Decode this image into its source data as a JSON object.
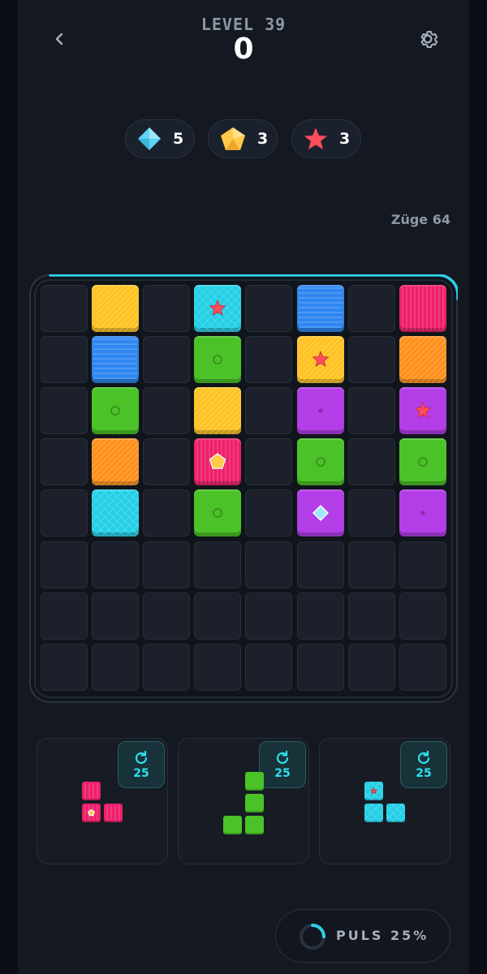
{
  "header": {
    "level_label": "LEVEL 39",
    "score": "0",
    "back_icon": "chevron-left-icon",
    "settings_icon": "gear-icon"
  },
  "goals": [
    {
      "icon": "diamond-icon",
      "color": "#5fd3f3",
      "count": "5"
    },
    {
      "icon": "pentagon-gem-icon",
      "color": "#ffc94a",
      "count": "3"
    },
    {
      "icon": "star-icon",
      "color": "#ff4d5a",
      "count": "3"
    }
  ],
  "moves_label": "Züge 64",
  "colors": {
    "yellow": "#ffc21f",
    "cyan": "#22cfe6",
    "blue": "#2f86f0",
    "magenta": "#ee1f6a",
    "green": "#4bc228",
    "orange": "#ff8f1a",
    "purple": "#b33ee8",
    "accent": "#2ecfea"
  },
  "board": {
    "size": 8,
    "tiles": [
      {
        "row": 0,
        "col": 1,
        "color": "yellow",
        "icon": ""
      },
      {
        "row": 0,
        "col": 3,
        "color": "cyan",
        "icon": "star"
      },
      {
        "row": 0,
        "col": 5,
        "color": "blue",
        "icon": ""
      },
      {
        "row": 0,
        "col": 7,
        "color": "magenta",
        "icon": ""
      },
      {
        "row": 1,
        "col": 1,
        "color": "blue",
        "icon": ""
      },
      {
        "row": 1,
        "col": 3,
        "color": "green",
        "icon": "ring"
      },
      {
        "row": 1,
        "col": 5,
        "color": "yellow",
        "icon": "star"
      },
      {
        "row": 1,
        "col": 7,
        "color": "orange",
        "icon": ""
      },
      {
        "row": 2,
        "col": 1,
        "color": "green",
        "icon": "ring"
      },
      {
        "row": 2,
        "col": 3,
        "color": "yellow",
        "icon": ""
      },
      {
        "row": 2,
        "col": 5,
        "color": "purple",
        "icon": "dot"
      },
      {
        "row": 2,
        "col": 7,
        "color": "purple",
        "icon": "star"
      },
      {
        "row": 3,
        "col": 1,
        "color": "orange",
        "icon": ""
      },
      {
        "row": 3,
        "col": 3,
        "color": "magenta",
        "icon": "pentagon"
      },
      {
        "row": 3,
        "col": 5,
        "color": "green",
        "icon": "ring"
      },
      {
        "row": 3,
        "col": 7,
        "color": "green",
        "icon": "ring"
      },
      {
        "row": 4,
        "col": 1,
        "color": "cyan",
        "icon": ""
      },
      {
        "row": 4,
        "col": 3,
        "color": "green",
        "icon": "ring"
      },
      {
        "row": 4,
        "col": 5,
        "color": "purple",
        "icon": "diamond"
      },
      {
        "row": 4,
        "col": 7,
        "color": "purple",
        "icon": "dot"
      }
    ]
  },
  "pieces": [
    {
      "rotations": "25",
      "color": "magenta",
      "rotate_icon": "rotate-icon",
      "blocks": [
        {
          "r": 0,
          "c": 0,
          "icon": ""
        },
        {
          "r": 1,
          "c": 0,
          "icon": "pentagon"
        },
        {
          "r": 1,
          "c": 1,
          "icon": ""
        }
      ]
    },
    {
      "rotations": "25",
      "color": "green",
      "rotate_icon": "rotate-icon",
      "blocks": [
        {
          "r": 0,
          "c": 1,
          "icon": ""
        },
        {
          "r": 1,
          "c": 1,
          "icon": ""
        },
        {
          "r": 2,
          "c": 0,
          "icon": ""
        },
        {
          "r": 2,
          "c": 1,
          "icon": ""
        }
      ]
    },
    {
      "rotations": "25",
      "color": "cyan",
      "rotate_icon": "rotate-icon",
      "blocks": [
        {
          "r": 0,
          "c": 0,
          "icon": "star"
        },
        {
          "r": 1,
          "c": 0,
          "icon": ""
        },
        {
          "r": 1,
          "c": 1,
          "icon": ""
        }
      ]
    }
  ],
  "pulse": {
    "label": "PULS 25%",
    "progress": 0.25
  }
}
